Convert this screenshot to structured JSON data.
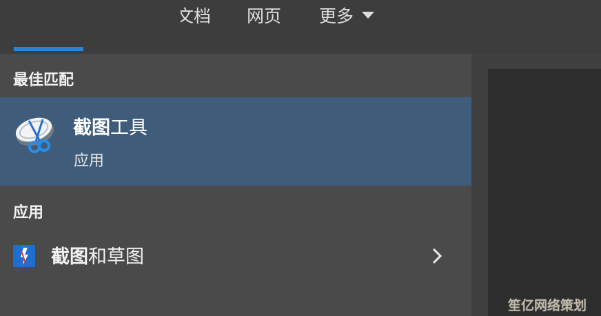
{
  "tabs": [
    {
      "label": "文档"
    },
    {
      "label": "网页"
    },
    {
      "label": "更多"
    }
  ],
  "best_match": {
    "heading": "最佳匹配",
    "item": {
      "title_bold": "截图",
      "title_rest": "工具",
      "subtitle": "应用",
      "icon": "snipping-tool-icon"
    }
  },
  "apps": {
    "heading": "应用",
    "items": [
      {
        "title_bold": "截图",
        "title_rest": "和草图",
        "icon": "snip-sketch-icon",
        "chevron": "chevron-right-icon"
      }
    ]
  },
  "watermark": "笙亿网络策划",
  "colors": {
    "accent": "#2b84d6",
    "selected_bg": "#3f5d7b",
    "pane_bg": "#4a4a4a"
  }
}
